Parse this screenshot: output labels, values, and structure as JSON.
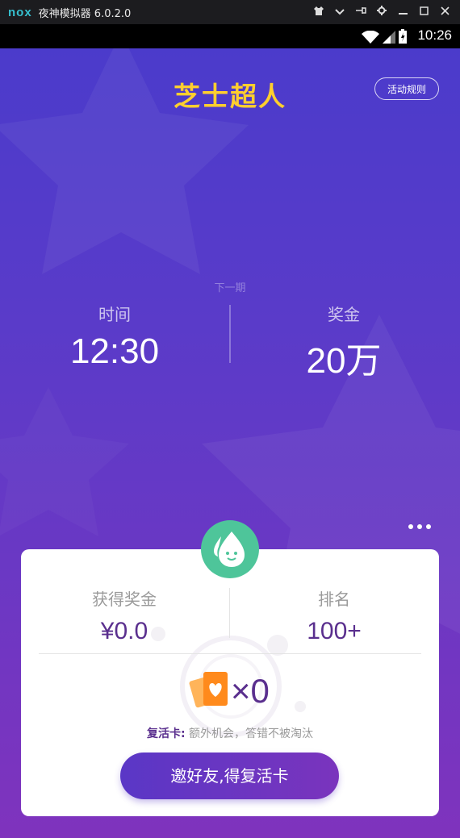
{
  "emulator": {
    "logo": "nox",
    "title": "夜神模拟器 6.0.2.0",
    "controls": [
      "shirt-icon",
      "chevron-down-icon",
      "pin-icon",
      "gear-icon",
      "minimize-icon",
      "maximize-icon",
      "close-icon"
    ]
  },
  "status_bar": {
    "time": "10:26"
  },
  "header": {
    "brand": "芝士超人",
    "rules_button": "活动规则"
  },
  "next_round": {
    "label": "下一期",
    "time_label": "时间",
    "time_value": "12:30",
    "prize_label": "奖金",
    "prize_value": "20万"
  },
  "card": {
    "earned_label": "获得奖金",
    "earned_value": "¥0.0",
    "rank_label": "排名",
    "rank_value": "100+",
    "revive_count": "×0",
    "revive_title": "复活卡:",
    "revive_desc": " 额外机会，答错不被淘汰",
    "invite_button": "邀好友,得复活卡"
  },
  "colors": {
    "brand": "#ffcf2e",
    "primary": "#5a37c6",
    "accent_purple": "#5a2f8e",
    "mascot": "#4ec59a",
    "revive_card": "#ff8a1c"
  }
}
